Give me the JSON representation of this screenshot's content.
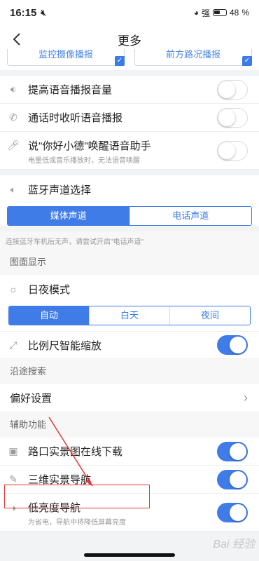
{
  "status": {
    "time": "16:15",
    "signal_label": "强",
    "battery": "48"
  },
  "nav": {
    "title": "更多"
  },
  "top_buttons": [
    "监控摄像播报",
    "前方路况播报"
  ],
  "voice": [
    {
      "label": "提高语音播报音量",
      "on": false
    },
    {
      "label": "通话时收听语音播报",
      "on": false
    },
    {
      "label": "说\"你好小德\"唤醒语音助手",
      "sub": "电量低或音乐播放时，无法语音唤醒",
      "on": false
    }
  ],
  "bluetooth": {
    "label": "蓝牙声道选择",
    "options": [
      "媒体声道",
      "电话声道"
    ],
    "selected": 0,
    "hint": "连接蓝牙车机后无声，请尝试开启\"电话声道\""
  },
  "display": {
    "title": "图面显示",
    "day_night_label": "日夜模式",
    "options": [
      "自动",
      "白天",
      "夜间"
    ],
    "selected": 0,
    "scale_label": "比例尺智能缩放",
    "scale_on": true
  },
  "search": {
    "title": "沿途搜索",
    "pref_label": "偏好设置"
  },
  "assist": {
    "title": "辅助功能",
    "items": [
      {
        "label": "路口实景图在线下载",
        "on": true
      },
      {
        "label": "三维实景导航",
        "on": true
      },
      {
        "label": "低亮度导航",
        "sub": "为省电，导航中将降低屏幕亮度",
        "on": true
      }
    ]
  },
  "watermark": "Bai 经验"
}
